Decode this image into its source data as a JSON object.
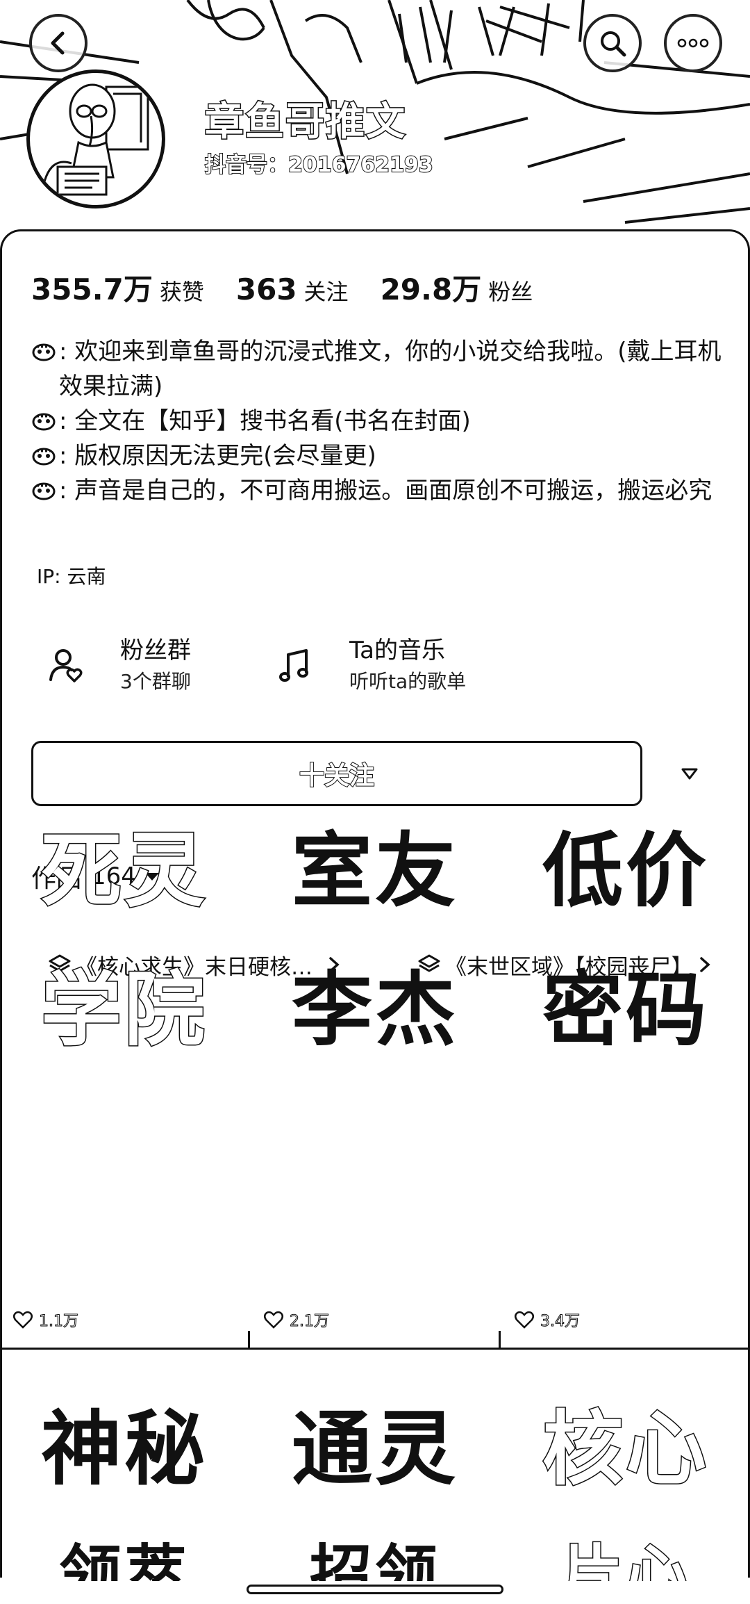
{
  "header": {
    "name": "章鱼哥推文",
    "account_id": "抖音号：2016762193"
  },
  "stats": [
    {
      "value": "355.7万",
      "label": "获赞"
    },
    {
      "value": "363",
      "label": "关注"
    },
    {
      "value": "29.8万",
      "label": "粉丝"
    }
  ],
  "bio": {
    "lines": [
      ": 欢迎来到章鱼哥的沉浸式推文，你的小说交给我啦。(戴上耳机效果拉满)",
      ": 全文在【知乎】搜书名看(书名在封面)",
      ": 版权原因无法更完(会尽量更)",
      ": 声音是自己的，不可商用搬运。画面原创不可搬运，搬运必究"
    ],
    "ip": "IP: 云南"
  },
  "quick_links": [
    {
      "title": "粉丝群",
      "subtitle": "3个群聊",
      "icon": "user-heart-icon"
    },
    {
      "title": "Ta的音乐",
      "subtitle": "听听ta的歌单",
      "icon": "music-note-icon"
    }
  ],
  "follow": {
    "label": "十关注"
  },
  "works": {
    "label": "作品",
    "count": "164"
  },
  "collections": [
    {
      "label": "《核心求生》末日硬核…"
    },
    {
      "label": "《末世区域》【校园丧尸】"
    }
  ],
  "grid": [
    {
      "top": "死灵",
      "bottom": "学院",
      "style": "outline",
      "likes": "1.1万"
    },
    {
      "top": "室友",
      "bottom": "李杰",
      "style": "solid",
      "likes": "2.1万"
    },
    {
      "top": "低价",
      "bottom": "密码",
      "style": "solid",
      "likes": "3.4万"
    },
    {
      "top": "神秘",
      "bottom": "",
      "style": "solid",
      "likes": ""
    },
    {
      "top": "通灵",
      "bottom": "",
      "style": "solid",
      "likes": ""
    },
    {
      "top": "核心",
      "bottom": "",
      "style": "outline",
      "likes": ""
    }
  ],
  "colors": {
    "ink": "#111111",
    "paper": "#ffffff"
  }
}
